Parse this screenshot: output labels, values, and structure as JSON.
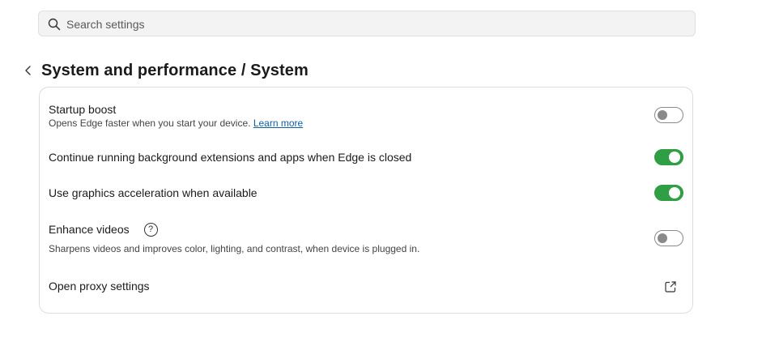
{
  "search": {
    "placeholder": "Search settings"
  },
  "header": {
    "title": "System and performance / System"
  },
  "settings": [
    {
      "label": "Startup boost",
      "description": "Opens Edge faster when you start your device.",
      "link": "Learn more",
      "state": "off"
    },
    {
      "label": "Continue running background extensions and apps when Edge is closed",
      "state": "on"
    },
    {
      "label": "Use graphics acceleration when available",
      "state": "on"
    },
    {
      "label": "Enhance videos",
      "description": "Sharpens videos and improves color, lighting, and contrast, when device is plugged in.",
      "state": "off",
      "help_icon": "question-circle-icon"
    },
    {
      "label": "Open proxy settings",
      "action_icon": "external-link-icon"
    }
  ],
  "colors": {
    "toggle_on": "#2f9e44",
    "toggle_off_border": "#8a8a8a",
    "link": "#115ea3"
  }
}
